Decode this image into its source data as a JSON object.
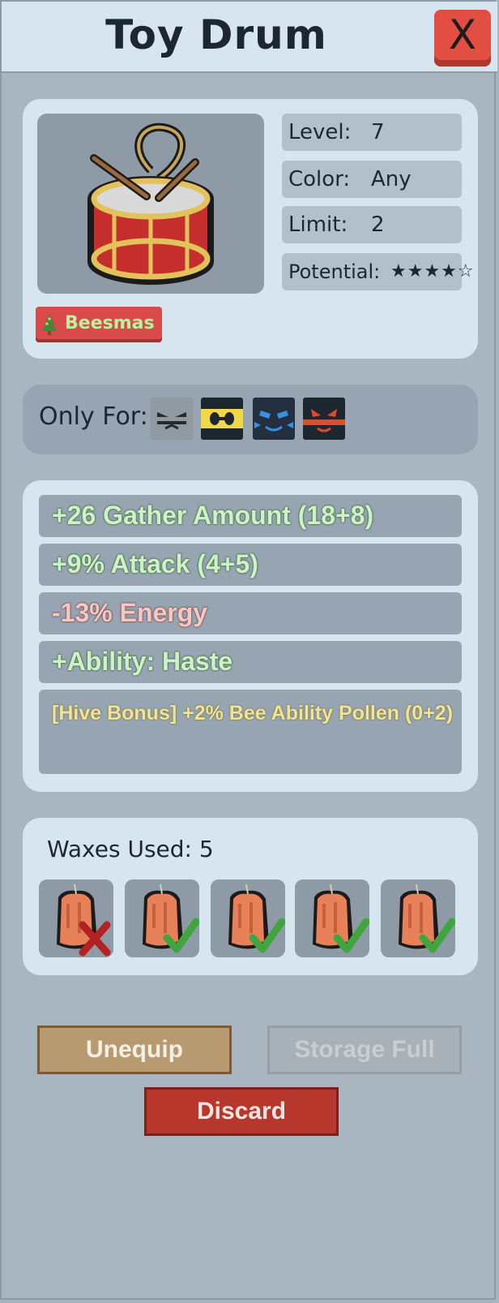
{
  "header": {
    "title": "Toy Drum",
    "close_label": "X"
  },
  "item": {
    "image_icon": "toy-drum-icon",
    "stats": [
      {
        "label": "Level:",
        "value": "7"
      },
      {
        "label": "Color:",
        "value": "Any"
      },
      {
        "label": "Limit:",
        "value": "2"
      },
      {
        "label": "Potential:",
        "value": "★★★★☆"
      }
    ],
    "event_badge": "Beesmas"
  },
  "only_for": {
    "label": "Only For:",
    "bees": [
      "ninja-bee-icon",
      "hasty-bee-icon",
      "cool-bee-icon",
      "demon-bee-icon"
    ]
  },
  "bonuses": [
    {
      "text": "+26 Gather Amount (18+8)",
      "kind": "positive"
    },
    {
      "text": "+9% Attack (4+5)",
      "kind": "positive"
    },
    {
      "text": "-13% Energy",
      "kind": "negative"
    },
    {
      "text": "+Ability: Haste",
      "kind": "positive"
    },
    {
      "text": "[Hive Bonus] +2% Bee Ability Pollen (0+2)",
      "kind": "hive"
    }
  ],
  "waxes": {
    "label": "Waxes Used:",
    "count": "5",
    "slots": [
      {
        "icon": "wax-icon",
        "result": "fail"
      },
      {
        "icon": "wax-icon",
        "result": "success"
      },
      {
        "icon": "wax-icon",
        "result": "success"
      },
      {
        "icon": "wax-icon",
        "result": "success"
      },
      {
        "icon": "wax-icon",
        "result": "success"
      }
    ]
  },
  "actions": {
    "unequip": "Unequip",
    "storage_full": "Storage Full",
    "discard": "Discard"
  }
}
